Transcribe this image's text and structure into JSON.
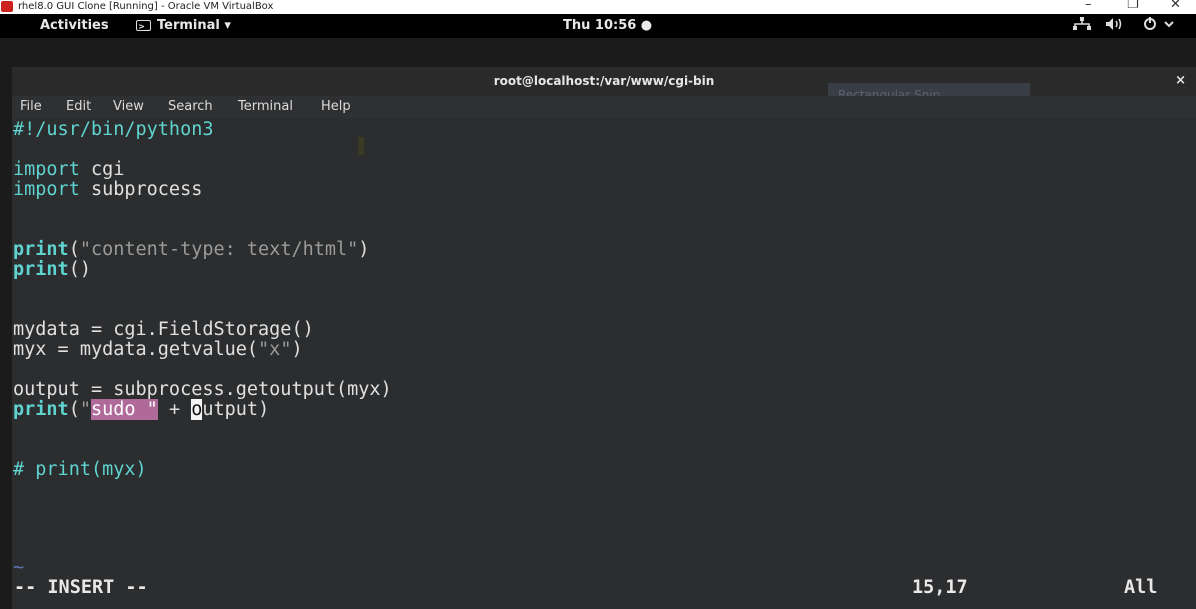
{
  "vbox": {
    "title": "rhel8.0 GUI Clone [Running] - Oracle VM VirtualBox",
    "minimize": "–",
    "restore": "❐",
    "close": "✕"
  },
  "topbar": {
    "activities": "Activities",
    "app_menu": "Terminal ▾",
    "app_icon": ">_",
    "clock": "Thu 10:56 ●",
    "network_icon": "network-icon",
    "volume_icon": "volume-icon",
    "power_icon": "power-icon"
  },
  "terminal": {
    "title": "root@localhost:/var/www/cgi-bin",
    "close": "×",
    "snip_overlay": "Rectangular Snip",
    "menu": [
      "File",
      "Edit",
      "View",
      "Search",
      "Terminal",
      "Help"
    ]
  },
  "code": {
    "shebang": "#!/usr/bin/python3",
    "kw_import": "import",
    "import1_mod": " cgi",
    "import2_mod": " subprocess",
    "print_kw": "print",
    "print1_open": "(",
    "print1_str": "\"content-type: text/html\"",
    "print1_close": ")",
    "print2_args": "()",
    "mydata_line": "mydata = cgi.FieldStorage()",
    "myx_pre": "myx = mydata.getvalue(",
    "myx_str": "\"x\"",
    "myx_post": ")",
    "output_line": "output = subprocess.getoutput(myx)",
    "print3_open": "(",
    "print3_q1": "\"",
    "print3_sel": "sudo \"",
    "print3_mid": " + ",
    "print3_cursor": "o",
    "print3_rest": "utput)",
    "comment": "# print(myx)",
    "tilde": "~"
  },
  "status": {
    "mode": "-- INSERT --",
    "position": "15,17",
    "scroll": "All"
  },
  "colors": {
    "keyword": "#5fd3cf",
    "string": "#9a9a9a",
    "selection": "#b06a9a",
    "background": "#2b2d2f"
  }
}
